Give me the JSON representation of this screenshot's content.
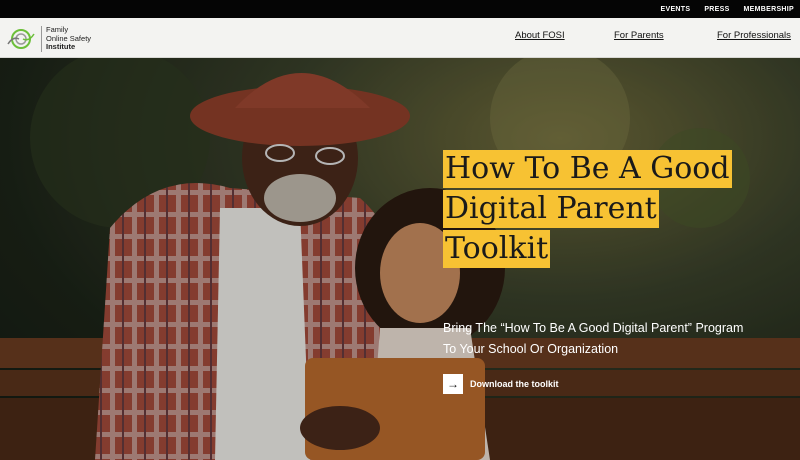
{
  "topbar": {
    "events": "EVENTS",
    "press": "PRESS",
    "membership": "MEMBERSHIP"
  },
  "logo": {
    "line1": "Family",
    "line2": "Online Safety",
    "line3": "Institute"
  },
  "nav": {
    "about": "About FOSI",
    "parents": "For Parents",
    "professionals": "For Professionals"
  },
  "hero": {
    "headline": [
      "How To Be A Good",
      "Digital Parent",
      "Toolkit"
    ],
    "subtitle_line1": "Bring The “How To Be A Good Digital Parent” Program",
    "subtitle_line2": "To Your School Or Organization",
    "cta_label": "Download the toolkit",
    "cta_icon": "arrow-right-icon"
  },
  "colors": {
    "highlight": "#f7c233",
    "nav_bg": "#f3f3f1",
    "topbar_bg": "#050505",
    "logo_green": "#6cbf3a"
  }
}
